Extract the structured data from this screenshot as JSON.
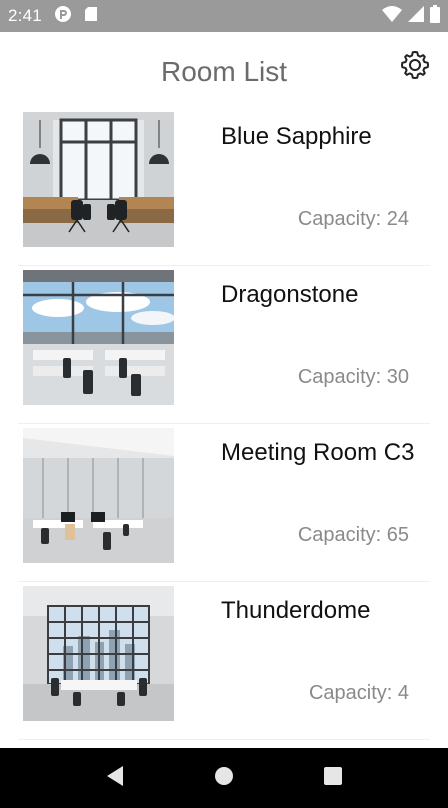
{
  "status_bar": {
    "time": "2:41",
    "icons": [
      "notification-badge-icon",
      "sd-card-icon",
      "wifi-icon",
      "cell-signal-icon",
      "battery-icon"
    ]
  },
  "header": {
    "title": "Room List",
    "settings_icon": "gear-icon"
  },
  "rooms": [
    {
      "name": "Blue Sapphire",
      "capacity_label": "Capacity:",
      "capacity": "24"
    },
    {
      "name": "Dragonstone",
      "capacity_label": "Capacity:",
      "capacity": "30"
    },
    {
      "name": "Meeting Room C3",
      "capacity_label": "Capacity:",
      "capacity": "65"
    },
    {
      "name": "Thunderdome",
      "capacity_label": "Capacity:",
      "capacity": "4"
    }
  ],
  "nav_bar": {
    "icons": [
      "back-icon",
      "home-icon",
      "recents-icon"
    ]
  },
  "colors": {
    "status_bar": "#9a9a9a",
    "title_text": "#6b6b6b",
    "capacity_text": "#8a8a8a",
    "nav_bar": "#000000"
  }
}
